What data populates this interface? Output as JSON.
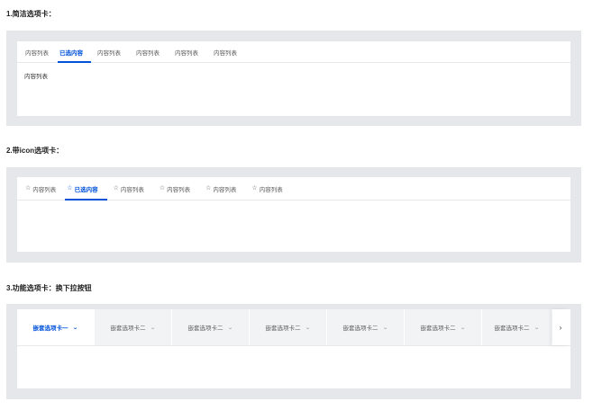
{
  "section1": {
    "title": "1.简洁选项卡：",
    "tabs": [
      "内容列表",
      "已选内容",
      "内容列表",
      "内容列表",
      "内容列表",
      "内容列表"
    ],
    "content": "内容列表"
  },
  "section2": {
    "title": "2.带icon选项卡：",
    "tabs": [
      "内容列表",
      "已选内容",
      "内容列表",
      "内容列表",
      "内容列表",
      "内容列表"
    ]
  },
  "section3": {
    "title": "3.功能选项卡：换下拉按钮",
    "tabs": [
      "嵌套选项卡一",
      "嵌套选项卡二",
      "嵌套选项卡二",
      "嵌套选项卡二",
      "嵌套选项卡二",
      "嵌套选项卡二",
      "嵌套选项卡二"
    ],
    "next_icon": "›"
  },
  "icons": {
    "tab_icon": "star-outline-icon",
    "dropdown_icon": "chevron-down-icon",
    "scroll_icon": "chevron-right-icon"
  },
  "colors": {
    "accent": "#0052d9",
    "panel_bg": "#e5e7eb",
    "tab_bg": "#f2f3f5"
  }
}
